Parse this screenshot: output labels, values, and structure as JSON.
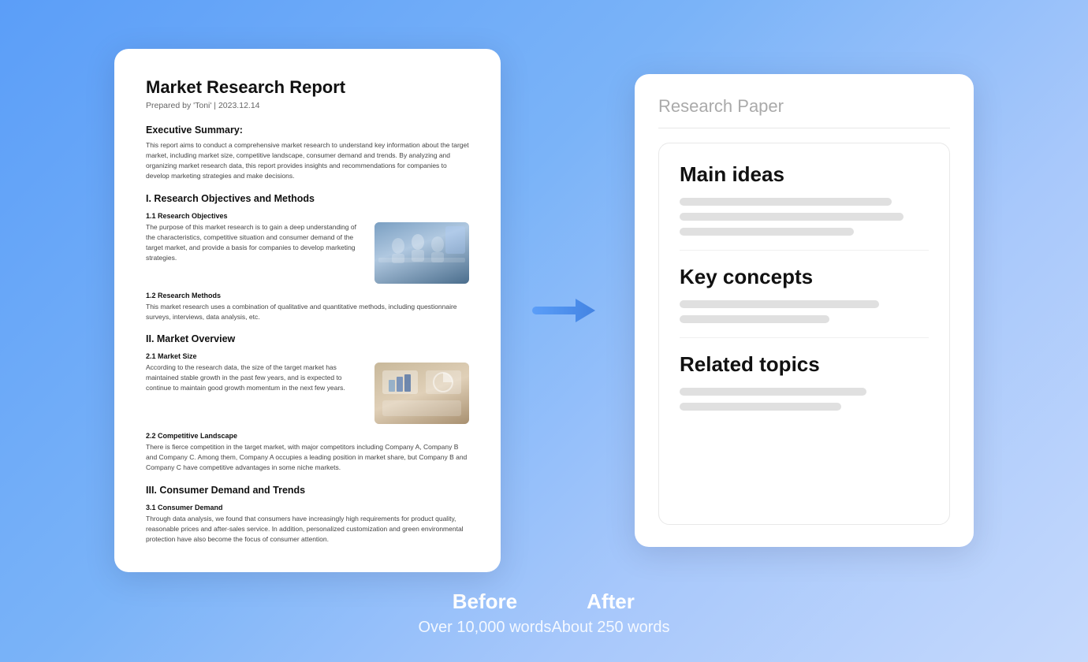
{
  "before": {
    "card_title": "Market Research Report",
    "doc_meta": "Prepared by 'Toni'  |  2023.12.14",
    "sections": [
      {
        "title": "Executive Summary:",
        "paragraphs": [
          "This report aims to conduct a comprehensive market research to understand key information about the target market, including market size, competitive landscape, consumer demand and trends. By analyzing and organizing market research data, this report provides insights and recommendations for companies to develop marketing strategies and make decisions."
        ]
      },
      {
        "title": "I. Research Objectives and Methods",
        "sub_sections": [
          {
            "sub_title": "1.1 Research Objectives",
            "text": "The purpose of this market research is to gain a deep understanding of the characteristics, competitive situation and consumer demand of the target market, and provide a basis for companies to develop marketing strategies.",
            "has_image": true,
            "image_type": "meeting"
          },
          {
            "sub_title": "1.2 Research Methods",
            "text": "This market research uses a combination of qualitative and quantitative methods, including questionnaire surveys, interviews, data analysis, etc.",
            "has_image": false
          }
        ]
      },
      {
        "title": "II. Market Overview",
        "sub_sections": [
          {
            "sub_title": "2.1 Market Size",
            "text": "According to the research data, the size of the target market has maintained stable growth in the past few years, and is expected to continue to maintain good growth momentum in the next few years.",
            "has_image": true,
            "image_type": "charts"
          },
          {
            "sub_title": "2.2 Competitive Landscape",
            "text": "There is fierce competition in the target market, with major competitors including Company A, Company B and Company C. Among them, Company A occupies a leading position in market share, but Company B and Company C have competitive advantages in some niche markets.",
            "has_image": false
          }
        ]
      },
      {
        "title": "III. Consumer Demand and Trends",
        "sub_sections": [
          {
            "sub_title": "3.1 Consumer Demand",
            "text": "Through data analysis, we found that consumers have increasingly high requirements for product quality, reasonable prices and after-sales service. In addition, personalized customization and green environmental protection have also become the focus of consumer attention.",
            "has_image": false
          }
        ]
      }
    ],
    "label_main": "Before",
    "label_sub": "Over 10,000 words"
  },
  "after": {
    "card_title": "Research Paper",
    "sections": [
      {
        "heading": "Main ideas",
        "bars": [
          {
            "width": "85%"
          },
          {
            "width": "90%"
          },
          {
            "width": "70%"
          }
        ]
      },
      {
        "heading": "Key concepts",
        "bars": [
          {
            "width": "80%"
          },
          {
            "width": "60%"
          }
        ]
      },
      {
        "heading": "Related topics",
        "bars": [
          {
            "width": "75%"
          },
          {
            "width": "65%"
          }
        ]
      }
    ],
    "label_main": "After",
    "label_sub": "About 250 words"
  }
}
